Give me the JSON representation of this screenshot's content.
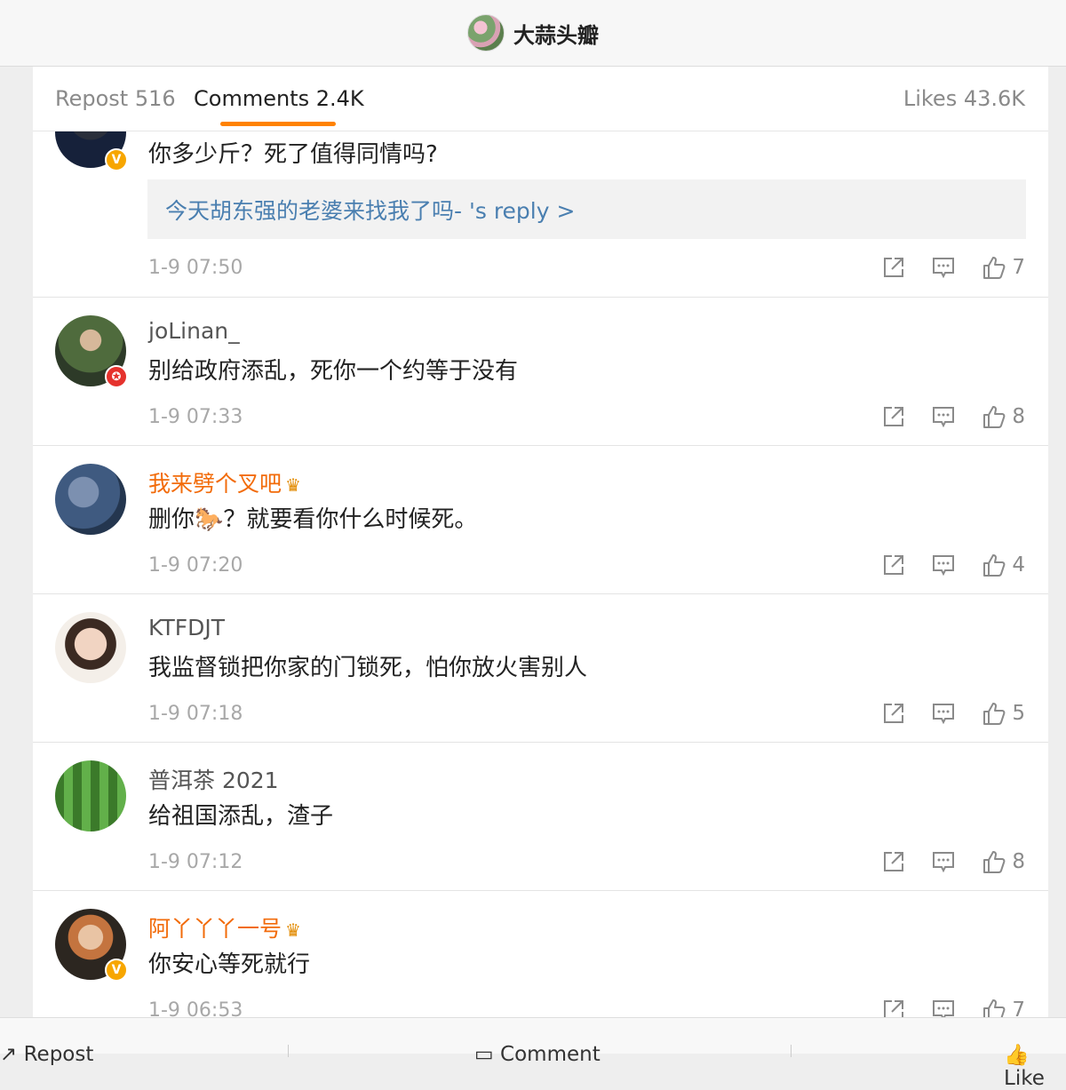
{
  "header": {
    "title": "大蒜头瓣"
  },
  "tabs": {
    "repost": "Repost 516",
    "comments": "Comments 2.4K",
    "likes": "Likes 43.6K",
    "accent_color": "#ff8200"
  },
  "comments": [
    {
      "text": "你多少斤？死了值得同情吗?",
      "reply_link": "今天胡东强的老婆来找我了吗-  's reply >",
      "time": "1-9 07:50",
      "likes": "7",
      "badge": "V"
    },
    {
      "name": "joLinan_",
      "text": "别给政府添乱，死你一个约等于没有",
      "time": "1-9 07:33",
      "likes": "8",
      "badge": "✪"
    },
    {
      "name": "我来劈个叉吧",
      "text": "删你🐎？就要看你什么时候死。",
      "time": "1-9 07:20",
      "likes": "4"
    },
    {
      "name": "KTFDJT",
      "text": "我监督锁把你家的门锁死，怕你放火害别人",
      "time": "1-9 07:18",
      "likes": "5"
    },
    {
      "name": "普洱茶 2021",
      "text": "给祖国添乱，渣子",
      "time": "1-9 07:12",
      "likes": "8"
    },
    {
      "name": "阿丫丫丫一号",
      "text": "你安心等死就行",
      "time": "1-9 06:53",
      "likes": "7",
      "badge": "V"
    }
  ],
  "bottom_bar": {
    "repost": "Repost",
    "comment": "Comment",
    "like": "Like"
  }
}
